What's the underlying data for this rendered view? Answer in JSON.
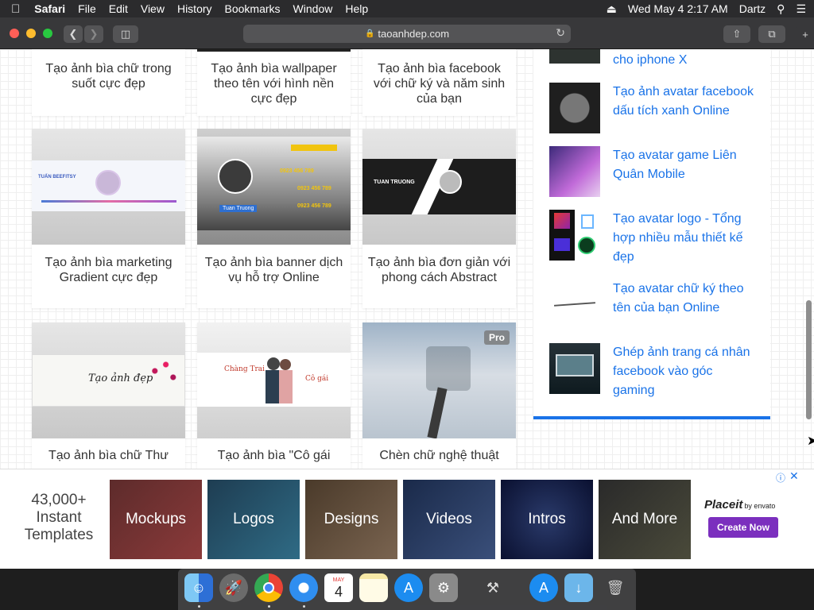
{
  "menubar": {
    "apple": "",
    "app": "Safari",
    "items": [
      "File",
      "Edit",
      "View",
      "History",
      "Bookmarks",
      "Window",
      "Help"
    ],
    "datetime": "Wed May 4  2:17 AM",
    "user": "Dartz"
  },
  "toolbar": {
    "url": "taoanhdep.com"
  },
  "cards": [
    {
      "title": "Tạo ảnh bìa chữ trong suốt cực đẹp"
    },
    {
      "title": "Tạo ảnh bìa wallpaper theo tên với hình nền cực đẹp"
    },
    {
      "title": "Tạo ảnh bìa facebook với chữ ký và năm sinh của bạn"
    },
    {
      "title": "Tạo ảnh bìa marketing Gradient cực đẹp",
      "thumb_text": "TUẤN BEEFITSY"
    },
    {
      "title": "Tạo ảnh bìa banner dịch vụ hỗ trợ Online",
      "thumb_text": "Tuan Truong",
      "phones": [
        "0923 456 789",
        "0923 456 789",
        "0923 456 789"
      ]
    },
    {
      "title": "Tạo ảnh bìa đơn giản với phong cách Abstract",
      "thumb_text": "TUAN TRUONG"
    },
    {
      "title": "Tạo ảnh bìa chữ Thư",
      "thumb_text": "Tạo ảnh đẹp"
    },
    {
      "title": "Tạo ảnh bìa \"Cô gái",
      "thumb_text_left": "Chàng Trai",
      "thumb_text_right": "Cô gái"
    },
    {
      "title": "Chèn chữ nghệ thuật",
      "badge": "Pro"
    }
  ],
  "sidebar": {
    "items": [
      {
        "text": "cho iphone X"
      },
      {
        "text": "Tạo ảnh avatar facebook dấu tích xanh Online"
      },
      {
        "text": "Tạo avatar game Liên Quân Mobile"
      },
      {
        "text": "Tạo avatar logo - Tổng hợp nhiều mẫu thiết kế đẹp"
      },
      {
        "text": "Tạo avatar chữ ký theo tên của bạn Online"
      },
      {
        "text": "Ghép ảnh trang cá nhân facebook vào góc gaming"
      }
    ]
  },
  "ad": {
    "headline": "43,000+ Instant Templates",
    "tiles": [
      "Mockups",
      "Logos",
      "Designs",
      "Videos",
      "Intros",
      "And More"
    ],
    "brand": "Placeit",
    "brand_by": "by envato",
    "cta": "Create Now"
  },
  "dock": {
    "calendar_month": "MAY",
    "calendar_day": "4"
  },
  "colors": {
    "link": "#1a73e8",
    "cta": "#7b2fbe",
    "menubar": "#2b2b2d"
  }
}
